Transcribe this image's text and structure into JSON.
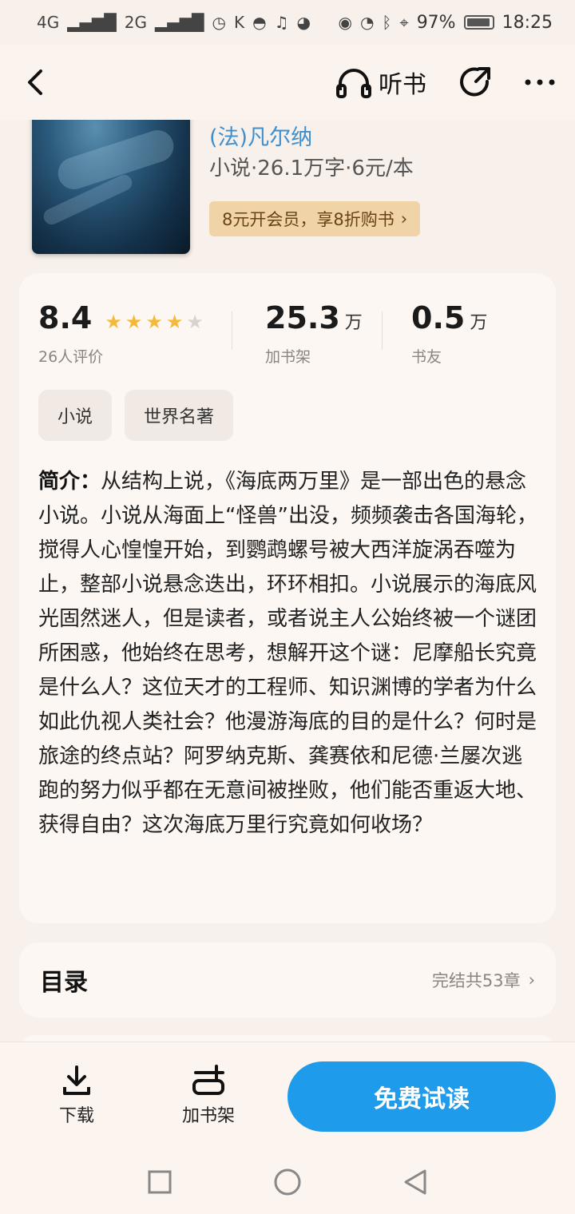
{
  "status_bar": {
    "signal1": "4G",
    "signal2": "2G",
    "battery": "97%",
    "time": "18:25"
  },
  "topbar": {
    "listen_label": "听书"
  },
  "book": {
    "author": "(法)凡尔纳",
    "meta": "小说·26.1万字·6元/本",
    "vip_promo": "8元开会员，享8折购书"
  },
  "stats": {
    "rating": "8.4",
    "rating_stars": 4,
    "rating_count_label": "26人评价",
    "shelf_num": "25.3",
    "shelf_unit": "万",
    "shelf_label": "加书架",
    "friends_num": "0.5",
    "friends_unit": "万",
    "friends_label": "书友"
  },
  "tags": [
    "小说",
    "世界名著"
  ],
  "intro": {
    "label": "简介：",
    "text": "从结构上说，《海底两万里》是一部出色的悬念小说。小说从海面上“怪兽”出没，频频袭击各国海轮，搅得人心惶惶开始，到鹦鹉螺号被大西洋旋涡吞噬为止，整部小说悬念迭出，环环相扣。小说展示的海底风光固然迷人，但是读者，或者说主人公始终被一个谜团所困惑，他始终在思考，想解开这个谜：尼摩船长究竟是什么人？这位天才的工程师、知识渊博的学者为什么如此仇视人类社会？他漫游海底的目的是什么？何时是旅途的终点站？阿罗纳克斯、龚赛依和尼德·兰屡次逃跑的努力似乎都在无意间被挫败，他们能否重返大地、获得自由？这次海底万里行究竟如何收场？"
  },
  "catalog": {
    "title": "目录",
    "info": "完结共53章"
  },
  "actions": {
    "download": "下载",
    "add_shelf": "加书架",
    "read_free": "免费试读"
  },
  "colors": {
    "accent_blue": "#1e9bea",
    "author_blue": "#3d8fd0",
    "star": "#f5b93a",
    "vip_bg": "#f0d3a6"
  }
}
